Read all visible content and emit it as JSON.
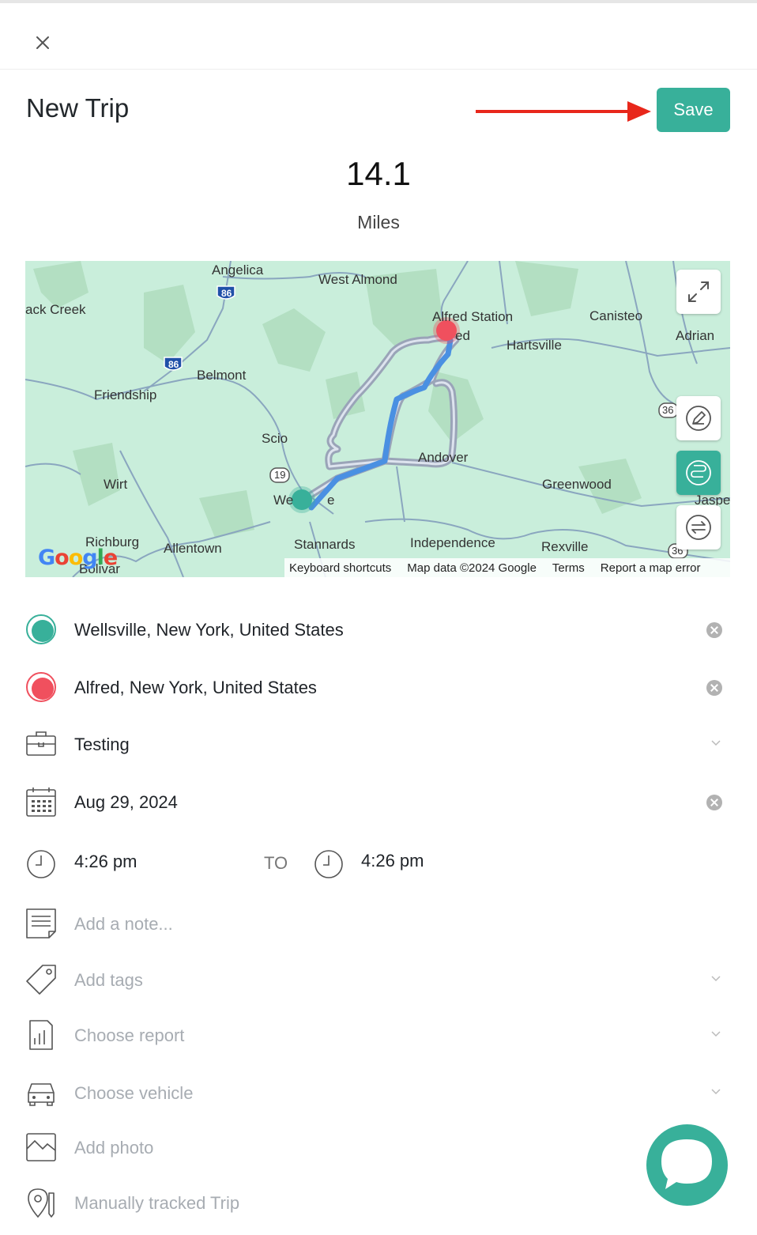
{
  "header": {
    "title": "New Trip",
    "save_label": "Save",
    "close_icon": "close-icon"
  },
  "trip": {
    "distance": "14.1",
    "unit": "Miles"
  },
  "map": {
    "labels": {
      "angelica": "Angelica",
      "west_almond": "West Almond",
      "back_creek": "ack Creek",
      "alfred_station": "Alfred Station",
      "canisteo": "Canisteo",
      "adrian": "Adrian",
      "hartsville": "Hartsville",
      "belmont": "Belmont",
      "friendship": "Friendship",
      "scio": "Scio",
      "andover": "Andover",
      "wirt": "Wirt",
      "greenwood": "Greenwood",
      "jasper": "Jaspe",
      "wellsville": "We",
      "wellsville_end": "e",
      "alfred_partial": "ed",
      "richburg": "Richburg",
      "allentown": "Allentown",
      "stannards": "Stannards",
      "independence": "Independence",
      "rexville": "Rexville",
      "bolivar": "Bolivar"
    },
    "shields": {
      "i86_a": "86",
      "i86_b": "86",
      "r19": "19",
      "r36_a": "36",
      "r36_b": "36"
    },
    "footer": {
      "keyboard": "Keyboard shortcuts",
      "map_data": "Map data ©2024 Google",
      "terms": "Terms",
      "report": "Report a map error"
    },
    "logo": "Google",
    "controls": [
      "expand-icon",
      "edit-route-icon",
      "route-icon",
      "swap-icon"
    ],
    "colors": {
      "route": "#4a90e2",
      "alt_route": "#9aa4b8",
      "start": "#38b09a",
      "end": "#f0505e",
      "map_bg": "#c9eedb"
    }
  },
  "form": {
    "start": "Wellsville, New York, United States",
    "end": "Alfred, New York, United States",
    "purpose": "Testing",
    "date": "Aug 29, 2024",
    "start_time": "4:26 pm",
    "to_label": "TO",
    "end_time": "4:26 pm",
    "note_placeholder": "Add a note...",
    "tags_placeholder": "Add tags",
    "report_placeholder": "Choose report",
    "vehicle_placeholder": "Choose vehicle",
    "photo_placeholder": "Add photo",
    "tracking": "Manually tracked Trip"
  },
  "accent": "#38b09a",
  "annotation_arrow_color": "#e8271b"
}
